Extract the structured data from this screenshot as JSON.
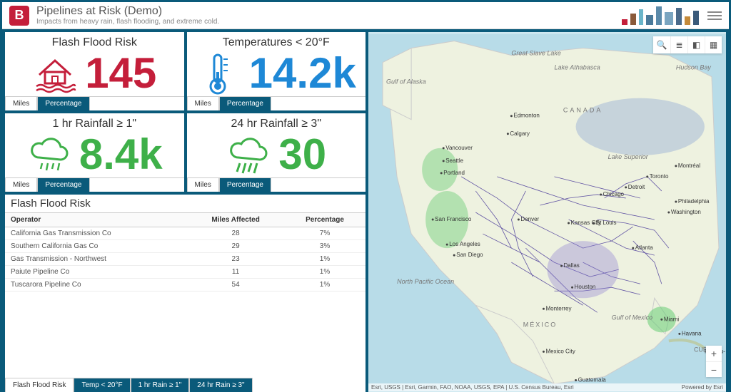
{
  "header": {
    "logo_letter": "B",
    "title": "Pipelines at Risk (Demo)",
    "subtitle": "Impacts from heavy rain, flash flooding, and extreme cold."
  },
  "stats": {
    "flash_flood": {
      "title": "Flash Flood Risk",
      "value": "145"
    },
    "temperature": {
      "title": "Temperatures < 20°F",
      "value": "14.2k"
    },
    "rain_1hr": {
      "title": "1 hr Rainfall ≥ 1\"",
      "value": "8.4k"
    },
    "rain_24hr": {
      "title": "24 hr Rainfall ≥ 3\"",
      "value": "30"
    },
    "tabs": {
      "miles": "Miles",
      "percentage": "Percentage"
    }
  },
  "table": {
    "title": "Flash Flood Risk",
    "columns": [
      "Operator",
      "Miles Affected",
      "Percentage"
    ],
    "rows": [
      {
        "op": "California Gas Transmission Co",
        "miles": "28",
        "pct": "7%"
      },
      {
        "op": "Southern California Gas Co",
        "miles": "29",
        "pct": "3%"
      },
      {
        "op": "Gas Transmission - Northwest",
        "miles": "23",
        "pct": "1%"
      },
      {
        "op": "Paiute Pipeline Co",
        "miles": "11",
        "pct": "1%"
      },
      {
        "op": "Tuscarora Pipeline Co",
        "miles": "54",
        "pct": "1%"
      }
    ],
    "bottom_tabs": [
      "Flash Flood Risk",
      "Temp < 20°F",
      "1 hr Rain ≥ 1\"",
      "24 hr Rain ≥ 3\""
    ]
  },
  "map": {
    "attribution_left": "Esri, USGS | Esri, Garmin, FAO, NOAA, USGS, EPA | U.S. Census Bureau, Esri",
    "attribution_right": "Powered by Esri",
    "labels": {
      "canada": "CANADA",
      "mexico": "MÉXICO",
      "cuba": "CUBA",
      "north_pacific": "North Pacific Ocean",
      "gulf_alaska": "Gulf of Alaska",
      "hudson_bay": "Hudson Bay",
      "great_slave": "Great Slave Lake",
      "athabasca": "Lake Athabasca",
      "superior": "Lake Superior",
      "gulf_mex": "Gulf of Mexico"
    },
    "cities": {
      "vancouver": "Vancouver",
      "seattle": "Seattle",
      "portland": "Portland",
      "sanfran": "San Francisco",
      "la": "Los Angeles",
      "sandiego": "San Diego",
      "edmonton": "Edmonton",
      "calgary": "Calgary",
      "denver": "Denver",
      "kc": "Kansas City",
      "dallas": "Dallas",
      "houston": "Houston",
      "chicago": "Chicago",
      "detroit": "Detroit",
      "toronto": "Toronto",
      "montreal": "Montréal",
      "stlouis": "St Louis",
      "atlanta": "Atlanta",
      "washington": "Washington",
      "philadelphia": "Philadelphia",
      "monterrey": "Monterrey",
      "mexicocity": "Mexico City",
      "guatemala": "Guatemala",
      "miami": "Miami",
      "havana": "Havana",
      "portau": "Port-au-"
    }
  }
}
